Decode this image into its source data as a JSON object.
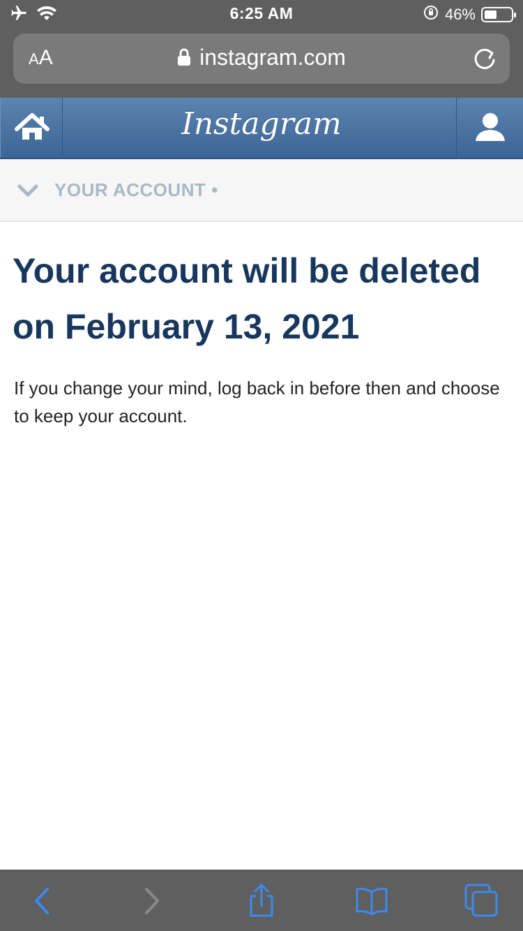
{
  "status_bar": {
    "time": "6:25 AM",
    "battery_percent": "46%",
    "battery_level": 0.46,
    "icons": [
      "airplane-icon",
      "wifi-icon",
      "orientation-lock-icon",
      "battery-icon"
    ]
  },
  "browser": {
    "text_size_label_small": "A",
    "text_size_label_large": "A",
    "url": "instagram.com"
  },
  "header": {
    "logo_text": "Instagram",
    "left_icon": "home-icon",
    "right_icon": "profile-icon",
    "color": "#4a72a1"
  },
  "section": {
    "title": "YOUR ACCOUNT •"
  },
  "main": {
    "headline": "Your account will be deleted on February 13, 2021",
    "body": "If you change your mind, log back in before then and choose to keep your account."
  },
  "toolbar": {
    "items": [
      "back-icon",
      "forward-icon",
      "share-icon",
      "bookmarks-icon",
      "tabs-icon"
    ],
    "accent": "#3b8af0"
  }
}
